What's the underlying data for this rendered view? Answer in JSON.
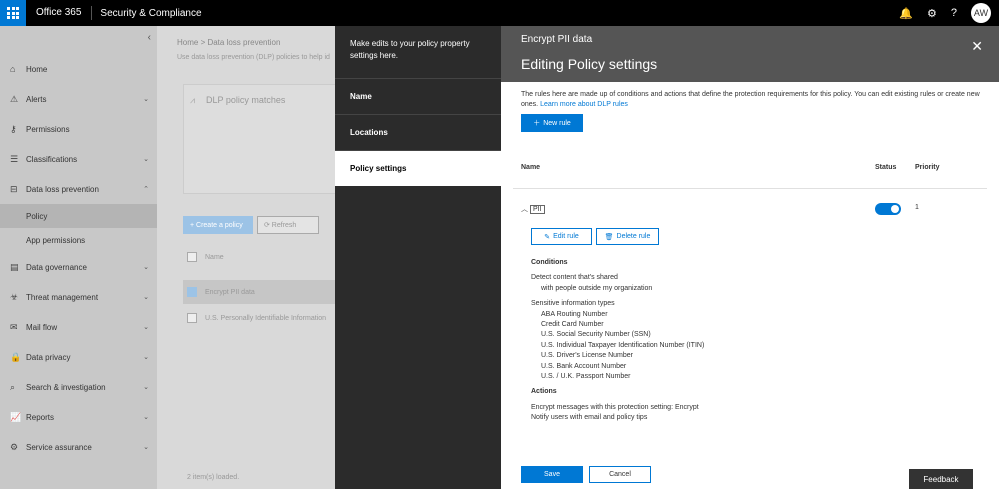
{
  "topbar": {
    "brand": "Office 365",
    "app_title": "Security & Compliance",
    "bell_icon": "🔔",
    "gear_icon": "⚙",
    "help_icon": "?",
    "avatar_initials": "AW"
  },
  "leftnav": {
    "collapse_glyph": "‹",
    "items": [
      {
        "icon": "⌂",
        "label": "Home",
        "chevron": ""
      },
      {
        "icon": "⚠",
        "label": "Alerts",
        "chevron": "⌄"
      },
      {
        "icon": "⚷",
        "label": "Permissions",
        "chevron": ""
      },
      {
        "icon": "☰",
        "label": "Classifications",
        "chevron": "⌄"
      },
      {
        "icon": "⊟",
        "label": "Data loss prevention",
        "chevron": "⌃"
      },
      {
        "icon": "▤",
        "label": "Data governance",
        "chevron": "⌄"
      },
      {
        "icon": "☣",
        "label": "Threat management",
        "chevron": "⌄"
      },
      {
        "icon": "✉",
        "label": "Mail flow",
        "chevron": "⌄"
      },
      {
        "icon": "🔒",
        "label": "Data privacy",
        "chevron": "⌄"
      },
      {
        "icon": "⌕",
        "label": "Search & investigation",
        "chevron": "⌄"
      },
      {
        "icon": "📈",
        "label": "Reports",
        "chevron": "⌄"
      },
      {
        "icon": "⚙",
        "label": "Service assurance",
        "chevron": "⌄"
      }
    ],
    "subitems": [
      {
        "label": "Policy"
      },
      {
        "label": "App permissions"
      }
    ]
  },
  "mainbg": {
    "breadcrumb": "Home  >  Data loss prevention",
    "description": "Use data loss prevention (DLP) policies to help id",
    "card_title": "DLP policy matches",
    "create_policy_label": "+ Create a policy",
    "refresh_label": "⟳ Refresh",
    "list_header": "Name",
    "rows": [
      {
        "label": "Encrypt PII data"
      },
      {
        "label": "U.S. Personally Identifiable Information"
      }
    ],
    "items_loaded": "2 item(s) loaded."
  },
  "wizard": {
    "intro": "Make edits to your policy property settings here.",
    "steps": [
      {
        "label": "Name"
      },
      {
        "label": "Locations"
      },
      {
        "label": "Policy settings"
      }
    ]
  },
  "flyout": {
    "subtitle": "Encrypt PII data",
    "title": "Editing Policy settings",
    "close_glyph": "✕",
    "description": "The rules here are made up of conditions and actions that define the protection requirements for this policy. You can edit existing rules or create new ones.",
    "learn_more": "Learn more about DLP rules",
    "new_rule_label": "New rule",
    "columns": {
      "name": "Name",
      "status": "Status",
      "priority": "Priority"
    },
    "rule": {
      "name": "PII",
      "priority": "1",
      "enabled": true,
      "edit_label": "Edit rule",
      "delete_label": "Delete rule",
      "conditions_heading": "Conditions",
      "condition_line1": "Detect content that's shared",
      "condition_line2": "with people outside my organization",
      "sit_heading": "Sensitive information types",
      "sit": [
        "ABA Routing Number",
        "Credit Card Number",
        "U.S. Social Security Number (SSN)",
        "U.S. Individual Taxpayer Identification Number (ITIN)",
        "U.S. Driver's License Number",
        "U.S. Bank Account Number",
        "U.S. / U.K. Passport Number"
      ],
      "actions_heading": "Actions",
      "actions": [
        "Encrypt messages with this protection setting: Encrypt",
        "Notify users with email and policy tips"
      ]
    },
    "save_label": "Save",
    "cancel_label": "Cancel",
    "feedback_label": "Feedback"
  }
}
